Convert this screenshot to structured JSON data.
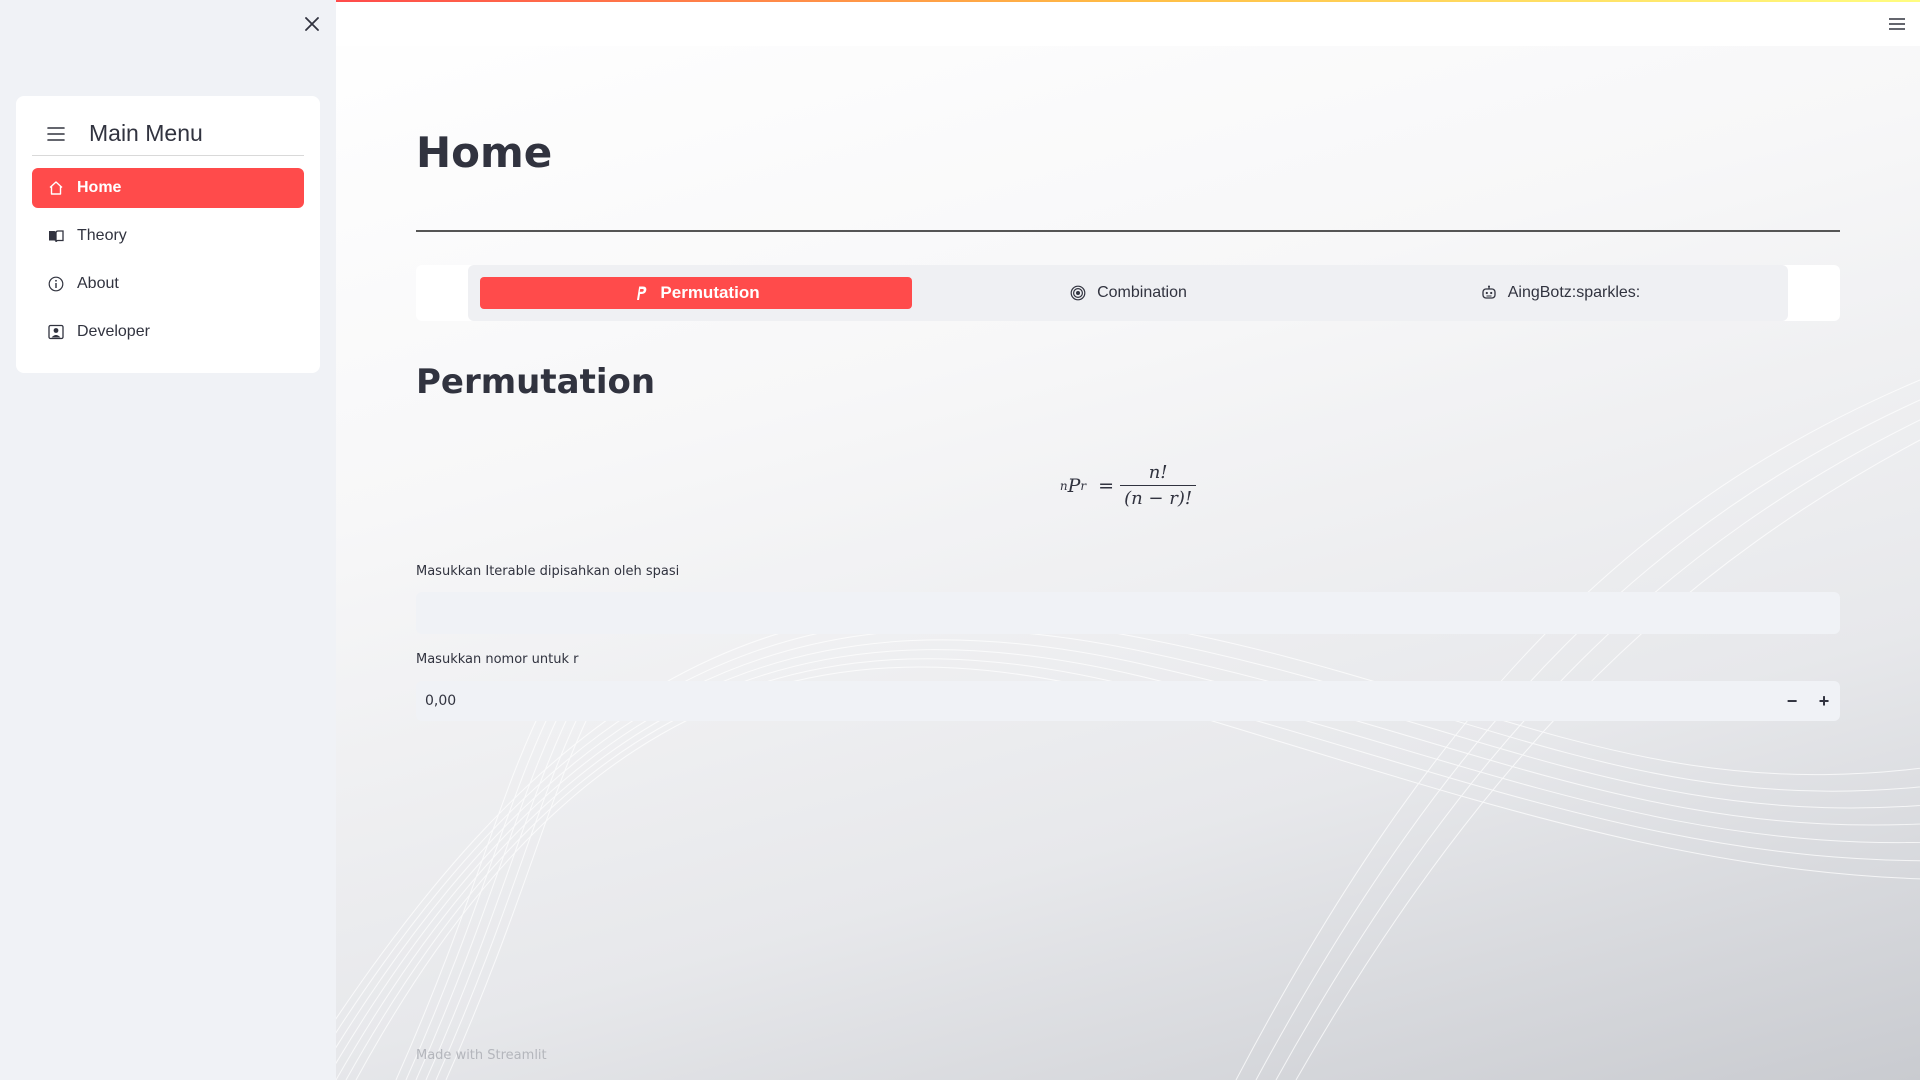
{
  "sidebar": {
    "menu_title": "Main Menu",
    "items": [
      {
        "label": "Home",
        "icon": "house-icon",
        "active": true
      },
      {
        "label": "Theory",
        "icon": "book-icon",
        "active": false
      },
      {
        "label": "About",
        "icon": "info-circle-icon",
        "active": false
      },
      {
        "label": "Developer",
        "icon": "person-badge-icon",
        "active": false
      }
    ]
  },
  "main": {
    "page_title": "Home",
    "tabs": [
      {
        "label": "Permutation",
        "icon": "paypal-icon",
        "active": true
      },
      {
        "label": "Combination",
        "icon": "target-icon",
        "active": false
      },
      {
        "label": "AingBotz:sparkles:",
        "icon": "robot-icon",
        "active": false
      }
    ],
    "section_title": "Permutation",
    "formula": {
      "sup": "n",
      "p": "P",
      "sub": "r",
      "eq": "=",
      "numerator": "n!",
      "denominator": "(n − r)!"
    },
    "iterable_field": {
      "label": "Masukkan Iterable dipisahkan oleh spasi",
      "value": "",
      "placeholder": ""
    },
    "r_field": {
      "label": "Masukkan nomor untuk r",
      "value": "0,00",
      "minus": "−",
      "plus": "+"
    },
    "footer": "Made with Streamlit"
  },
  "colors": {
    "accent": "#ff4b4b",
    "sidebar_bg": "#f0f2f6",
    "text": "#31333f"
  }
}
